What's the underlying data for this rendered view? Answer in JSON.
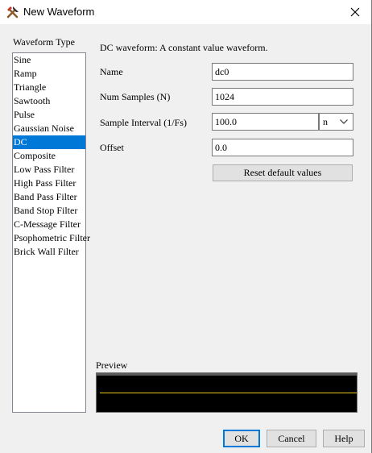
{
  "window": {
    "title": "New Waveform"
  },
  "waveform_type": {
    "label": "Waveform Type",
    "items": [
      {
        "label": "Sine"
      },
      {
        "label": "Ramp"
      },
      {
        "label": "Triangle"
      },
      {
        "label": "Sawtooth"
      },
      {
        "label": "Pulse"
      },
      {
        "label": "Gaussian Noise"
      },
      {
        "label": "DC",
        "selected": true
      },
      {
        "label": "Composite"
      },
      {
        "label": "Low Pass Filter"
      },
      {
        "label": "High Pass Filter"
      },
      {
        "label": "Band Pass Filter"
      },
      {
        "label": "Band Stop Filter"
      },
      {
        "label": "C-Message Filter"
      },
      {
        "label": "Psophometric Filter"
      },
      {
        "label": "Brick Wall Filter"
      }
    ]
  },
  "description": "DC waveform:  A constant value waveform.",
  "form": {
    "name": {
      "label": "Name",
      "value": "dc0"
    },
    "num_samples": {
      "label": "Num Samples (N)",
      "value": "1024"
    },
    "sample_interval": {
      "label": "Sample Interval (1/Fs)",
      "value": "100.0",
      "unit": "n"
    },
    "offset": {
      "label": "Offset",
      "value": "0.0"
    },
    "reset_label": "Reset default values"
  },
  "preview": {
    "label": "Preview",
    "line_color": "#e8c81a"
  },
  "buttons": {
    "ok": "OK",
    "cancel": "Cancel",
    "help": "Help"
  },
  "colors": {
    "selection": "#0078d7",
    "dialog_bg": "#f0f0f0"
  }
}
